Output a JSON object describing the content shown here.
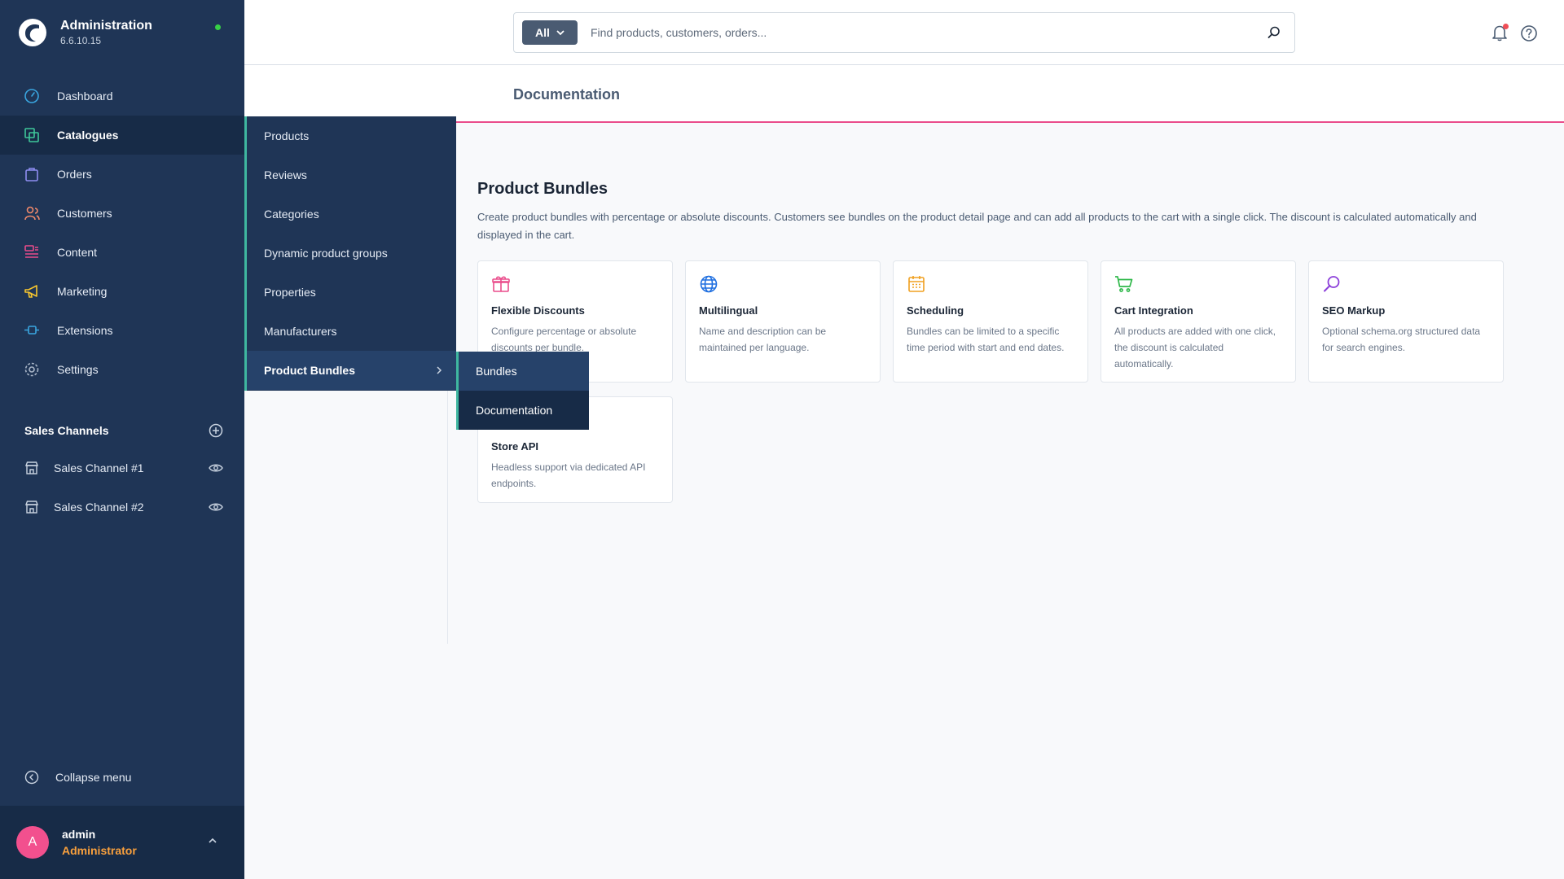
{
  "app": {
    "title": "Administration",
    "version": "6.6.10.15"
  },
  "nav": [
    {
      "label": "Dashboard",
      "icon": "gauge-icon"
    },
    {
      "label": "Catalogues",
      "icon": "catalogue-icon",
      "active": true
    },
    {
      "label": "Orders",
      "icon": "bag-icon"
    },
    {
      "label": "Customers",
      "icon": "users-icon"
    },
    {
      "label": "Content",
      "icon": "content-icon"
    },
    {
      "label": "Marketing",
      "icon": "megaphone-icon"
    },
    {
      "label": "Extensions",
      "icon": "plug-icon"
    },
    {
      "label": "Settings",
      "icon": "gear-icon"
    }
  ],
  "sales_channels": {
    "title": "Sales Channels",
    "items": [
      "Sales Channel #1",
      "Sales Channel #2"
    ]
  },
  "collapse_label": "Collapse menu",
  "user": {
    "initial": "A",
    "name": "admin",
    "role": "Administrator"
  },
  "flyout": {
    "items": [
      "Products",
      "Reviews",
      "Categories",
      "Dynamic product groups",
      "Properties",
      "Manufacturers",
      "Product Bundles"
    ],
    "sub_items": [
      "Bundles",
      "Documentation"
    ]
  },
  "search": {
    "scope": "All",
    "placeholder": "Find products, customers, orders..."
  },
  "page": {
    "title": "Documentation"
  },
  "section": {
    "title": "Product Bundles",
    "description": "Create product bundles with percentage or absolute discounts. Customers see bundles on the product detail page and can add all products to the cart with a single click. The discount is calculated automatically and displayed in the cart."
  },
  "cards": [
    {
      "title": "Flexible Discounts",
      "text": "Configure percentage or absolute discounts per bundle.",
      "icon": "gift-icon"
    },
    {
      "title": "Multilingual",
      "text": "Name and description can be maintained per language.",
      "icon": "globe-icon"
    },
    {
      "title": "Scheduling",
      "text": "Bundles can be limited to a specific time period with start and end dates.",
      "icon": "calendar-icon"
    },
    {
      "title": "Cart Integration",
      "text": "All products are added with one click, the discount is calculated automatically.",
      "icon": "cart-icon"
    },
    {
      "title": "SEO Markup",
      "text": "Optional schema.org structured data for search engines.",
      "icon": "search-icon"
    },
    {
      "title": "Store API",
      "text": "Headless support via dedicated API endpoints.",
      "icon": "api-icon"
    }
  ],
  "colors": {
    "sidebar": "#1f3556",
    "accent": "#ea4c8b",
    "flyout_border": "#3fb7a0"
  }
}
